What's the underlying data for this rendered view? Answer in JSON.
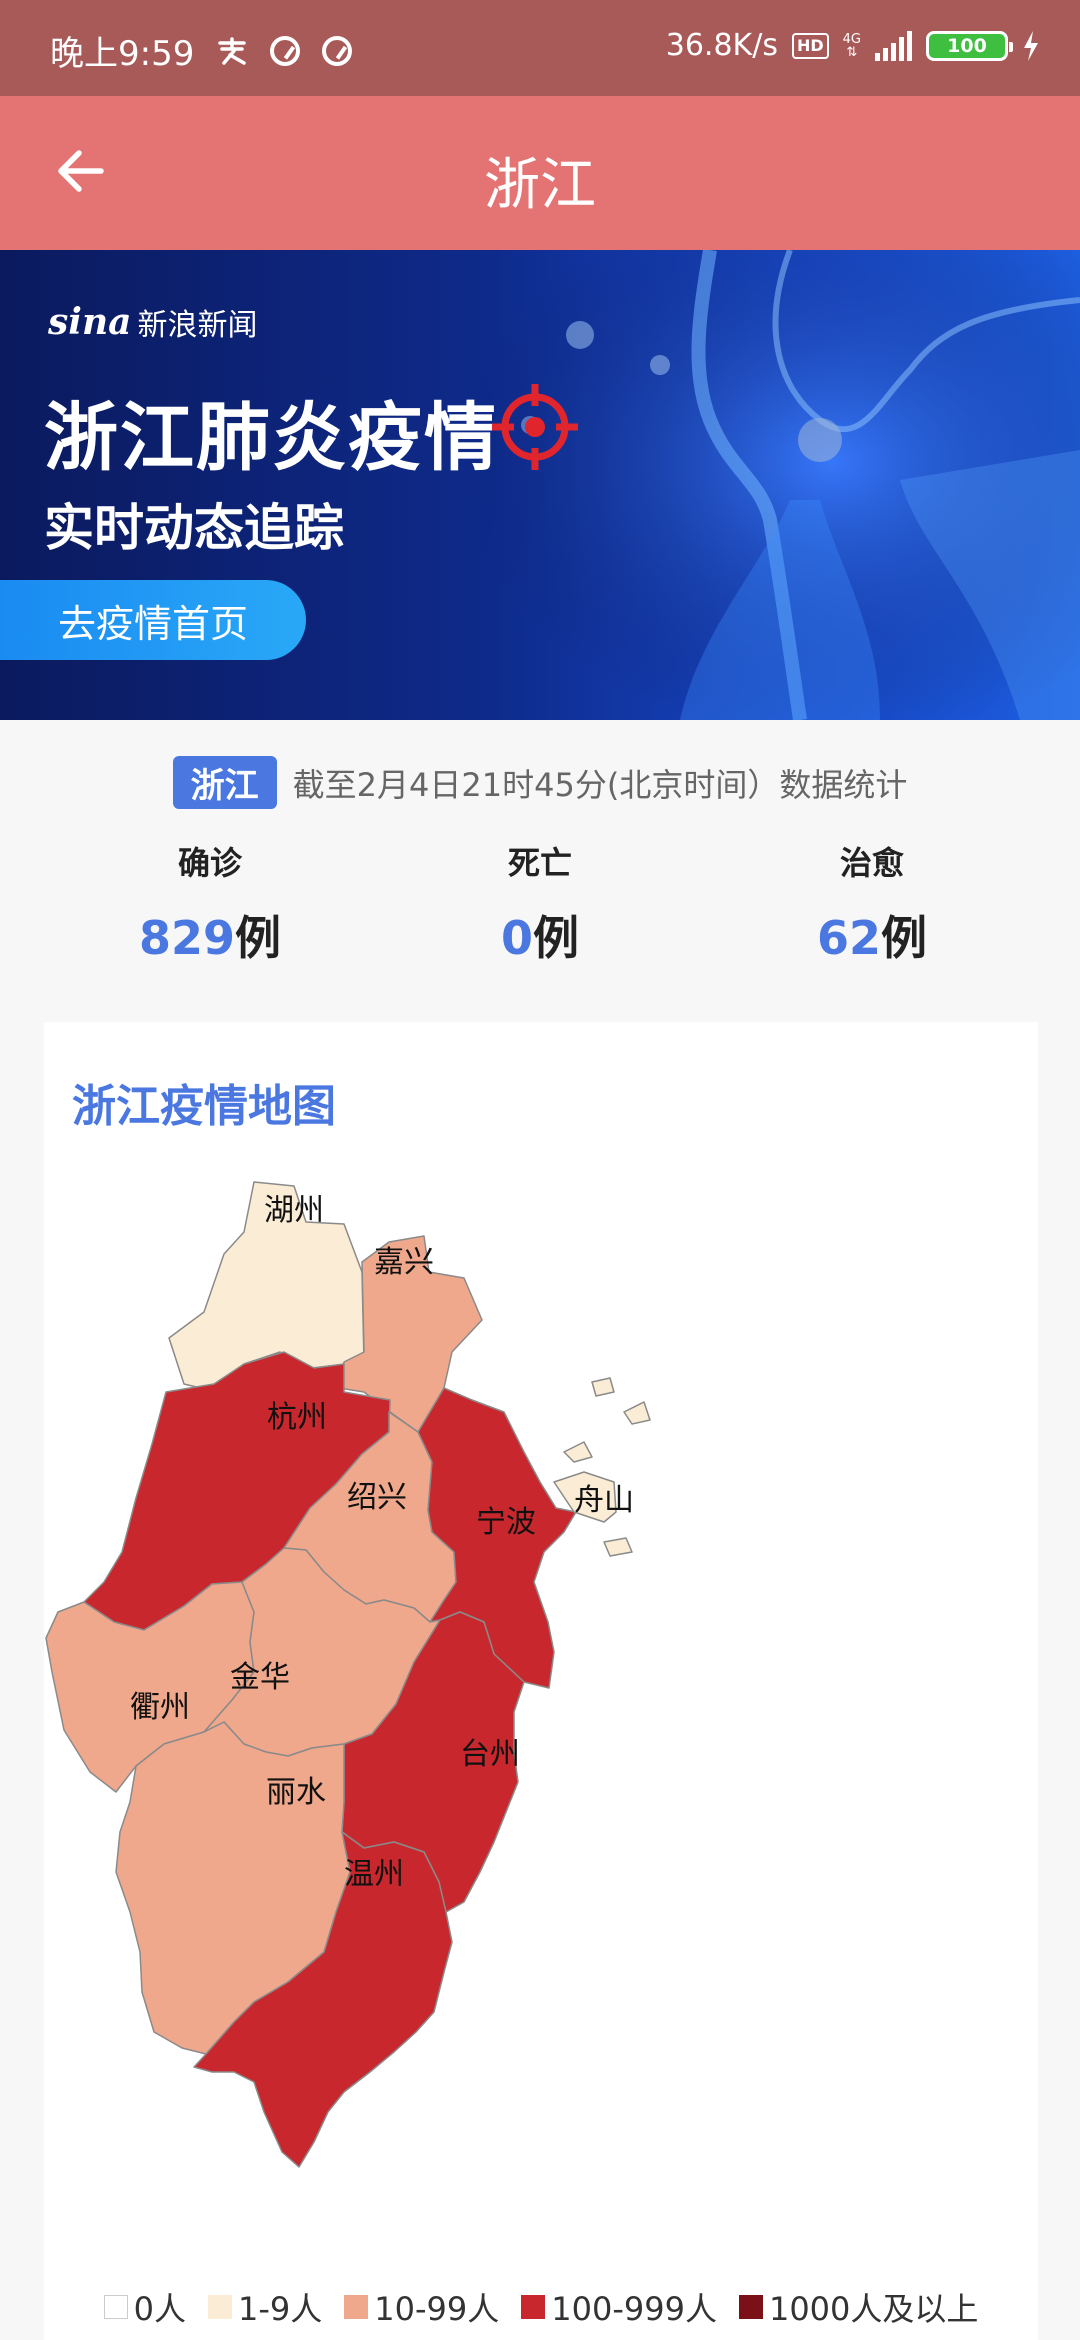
{
  "status_bar": {
    "time": "晚上9:59",
    "speed": "36.8K/s",
    "hd": "HD",
    "network": "4G",
    "battery": "100"
  },
  "app_bar": {
    "title": "浙江"
  },
  "banner": {
    "brand": "sina",
    "brand_name": "新浪新闻",
    "title": "浙江肺炎疫情",
    "subtitle": "实时动态追踪",
    "button_label": "去疫情首页"
  },
  "stats": {
    "region": "浙江",
    "as_of": "截至2月4日21时45分(北京时间）数据统计",
    "items": [
      {
        "label": "确诊",
        "value": "829",
        "unit": "例"
      },
      {
        "label": "死亡",
        "value": "0",
        "unit": "例"
      },
      {
        "label": "治愈",
        "value": "62",
        "unit": "例"
      }
    ]
  },
  "map": {
    "title": "浙江疫情地图",
    "colors": {
      "c0": "#ffffff",
      "c1": "#fbecd5",
      "c2": "#f0a88c",
      "c3": "#c8282d",
      "c4": "#7a1018",
      "stroke": "#8a8a8a"
    },
    "cities": [
      {
        "name": "湖州",
        "level": "1-9"
      },
      {
        "name": "嘉兴",
        "level": "10-99"
      },
      {
        "name": "杭州",
        "level": "100-999"
      },
      {
        "name": "绍兴",
        "level": "10-99"
      },
      {
        "name": "宁波",
        "level": "100-999"
      },
      {
        "name": "舟山",
        "level": "1-9"
      },
      {
        "name": "衢州",
        "level": "10-99"
      },
      {
        "name": "金华",
        "level": "10-99"
      },
      {
        "name": "台州",
        "level": "100-999"
      },
      {
        "name": "丽水",
        "level": "10-99"
      },
      {
        "name": "温州",
        "level": "100-999"
      }
    ],
    "legend": [
      {
        "label": "0人",
        "color": "#ffffff"
      },
      {
        "label": "1-9人",
        "color": "#fbecd5"
      },
      {
        "label": "10-99人",
        "color": "#f0a88c"
      },
      {
        "label": "100-999人",
        "color": "#c8282d"
      },
      {
        "label": "1000人及以上",
        "color": "#7a1018"
      }
    ]
  }
}
